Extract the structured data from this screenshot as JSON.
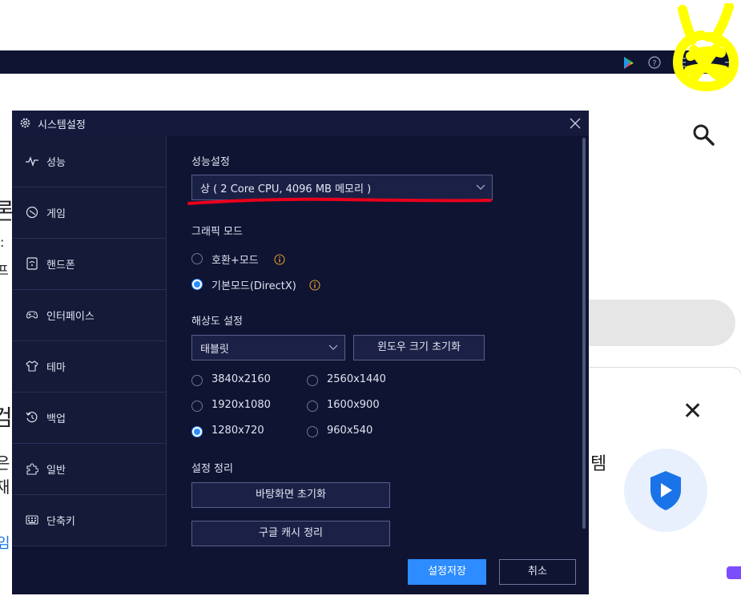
{
  "topbar": {
    "icons": [
      "play-store-icon",
      "help-icon",
      "menu-icon",
      "settings-gear-icon",
      "minimize-icon"
    ]
  },
  "background": {
    "fragments": [
      "론",
      ":",
      "프",
      "검",
      "은",
      "재",
      "임",
      "템"
    ],
    "close_glyph": "✕"
  },
  "dialog": {
    "title": "시스템설정",
    "sidebar": {
      "items": [
        {
          "label": "성능",
          "icon": "performance-icon"
        },
        {
          "label": "게임",
          "icon": "game-icon"
        },
        {
          "label": "핸드폰",
          "icon": "phone-icon"
        },
        {
          "label": "인터페이스",
          "icon": "gamepad-icon"
        },
        {
          "label": "테마",
          "icon": "shirt-icon"
        },
        {
          "label": "백업",
          "icon": "backup-icon"
        },
        {
          "label": "일반",
          "icon": "puzzle-icon"
        },
        {
          "label": "단축키",
          "icon": "keyboard-icon"
        }
      ],
      "active_index": 0
    },
    "performance": {
      "section_title": "성능설정",
      "selected": "상 ( 2 Core CPU, 4096 MB 메모리 )"
    },
    "graphics": {
      "section_title": "그래픽 모드",
      "options": [
        {
          "label": "호환+모드",
          "selected": false
        },
        {
          "label": "기본모드(DirectX)",
          "selected": true
        }
      ]
    },
    "resolution": {
      "section_title": "해상도 설정",
      "device_selected": "태블릿",
      "reset_button": "윈도우 크기 초기화",
      "options": [
        {
          "label": "3840x2160",
          "selected": false
        },
        {
          "label": "2560x1440",
          "selected": false
        },
        {
          "label": "1920x1080",
          "selected": false
        },
        {
          "label": "1600x900",
          "selected": false
        },
        {
          "label": "1280x720",
          "selected": true
        },
        {
          "label": "960x540",
          "selected": false
        }
      ]
    },
    "cleanup": {
      "section_title": "설정 정리",
      "desktop_reset_button": "바탕화면 초기화",
      "google_cache_button": "구글 캐시 정리"
    },
    "footer": {
      "save_label": "설정저장",
      "cancel_label": "취소"
    }
  },
  "colors": {
    "dialog_bg": "#101433",
    "sidebar_bg": "#151a38",
    "accent": "#2d8cff",
    "annotation_red": "#e8001c",
    "scribble_yellow": "#ffff00"
  }
}
